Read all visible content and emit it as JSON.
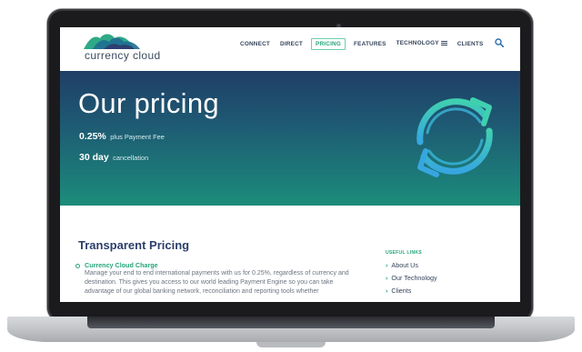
{
  "site": {
    "logo_text": "currency cloud"
  },
  "nav": {
    "items": [
      "CONNECT",
      "DIRECT",
      "PRICING",
      "FEATURES",
      "TECHNOLOGY",
      "CLIENTS"
    ],
    "active": "PRICING"
  },
  "icons": {
    "menu": "hamburger-icon",
    "search": "search-icon",
    "hero": "refresh-arrows-icon",
    "bullet": "circle-bullet-icon",
    "link": "chevron-right-icon"
  },
  "hero": {
    "title": "Our pricing",
    "fee_value": "0.25%",
    "fee_label": "plus Payment Fee",
    "cancel_value": "30 day",
    "cancel_label": "cancellation"
  },
  "content": {
    "title": "Transparent Pricing",
    "item_title": "Currency Cloud Charge",
    "item_body": "Manage your end to end international payments with us for 0.25%, regardless of currency and destination. This gives you access to our world leading Payment Engine so you can take advantage of our global banking network, reconciliation and reporting tools whether"
  },
  "sidebar": {
    "heading": "USEFUL LINKS",
    "links": [
      "About Us",
      "Our Technology",
      "Clients"
    ]
  },
  "colors": {
    "accent": "#27a57b",
    "navy": "#2c3f6b",
    "hero_top": "#1f3f66",
    "hero_bottom": "#1d8d7b",
    "icon": "#3fb8d9"
  }
}
